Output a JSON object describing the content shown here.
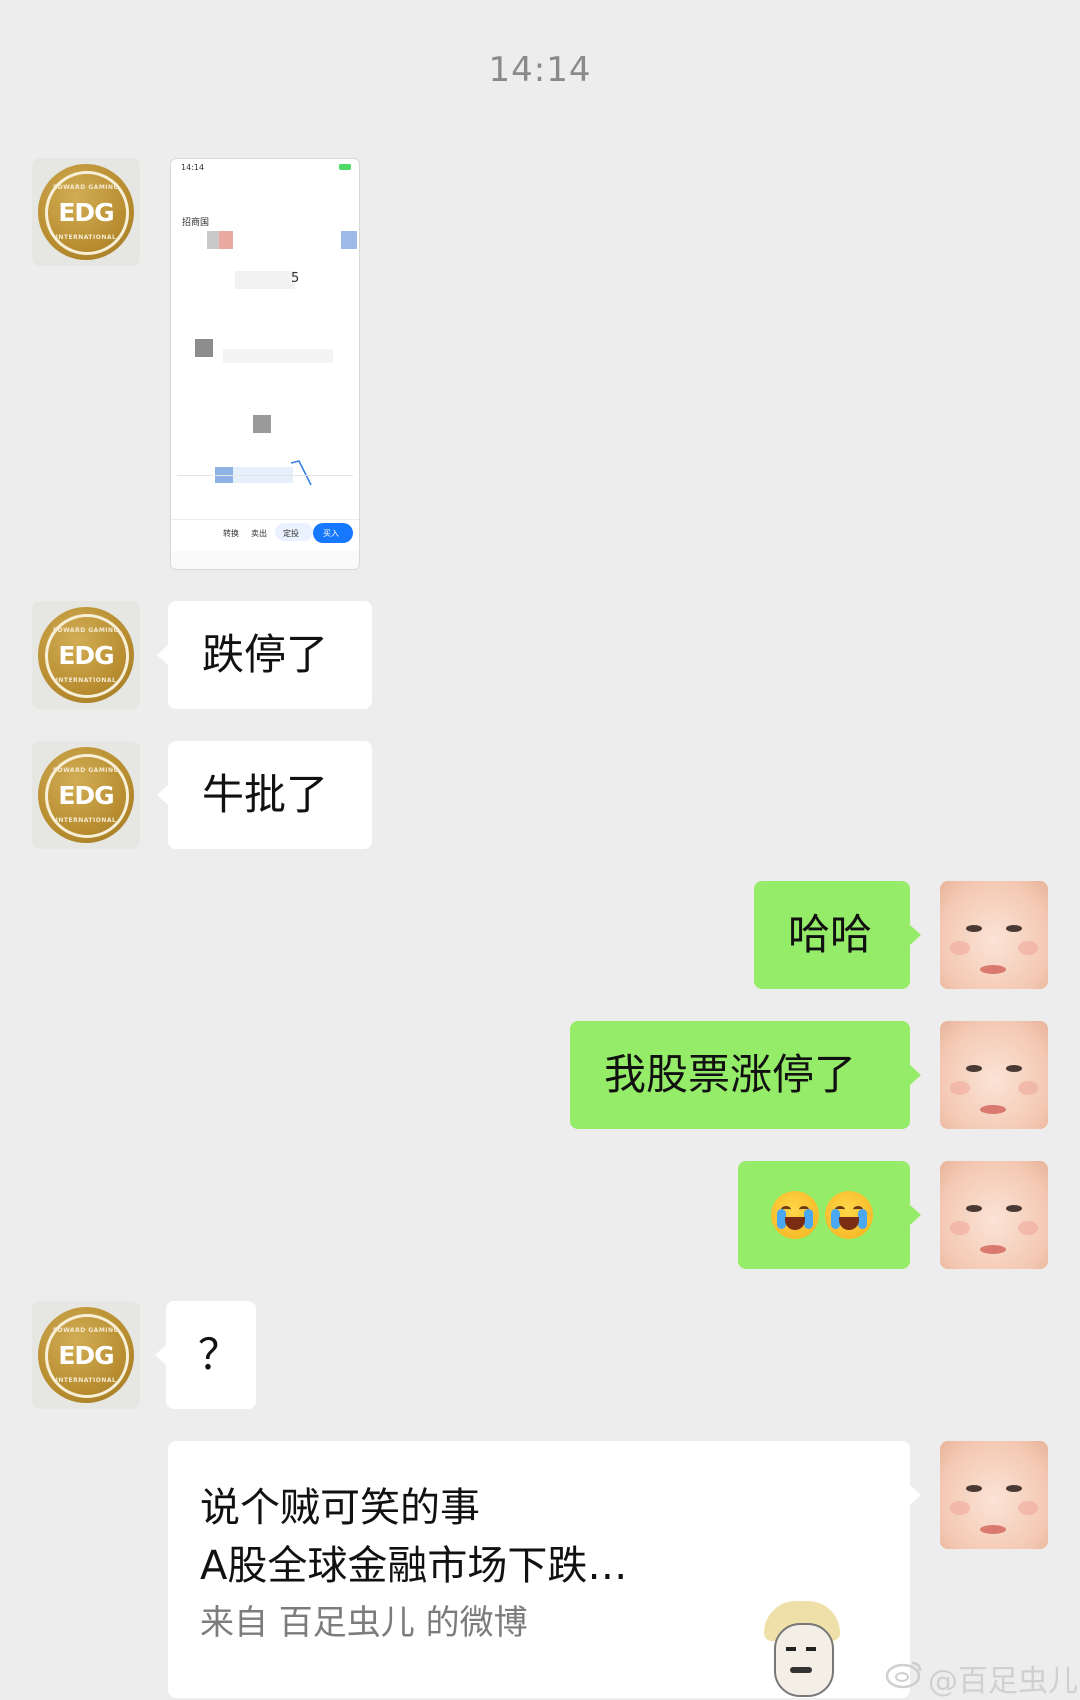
{
  "timestamp": "14:14",
  "messages": {
    "m2": "跌停了",
    "m3": "牛批了",
    "m4": "哈哈",
    "m5": "我股票涨停了",
    "m7": "？",
    "card": {
      "line1": "说个贼可笑的事",
      "line2": "A股全球金融市场下跌…",
      "source": "来自 百足虫儿 的微博"
    }
  },
  "screenshot": {
    "time": "14:14",
    "name": "招商国",
    "number": "5",
    "buttons": [
      "转换",
      "卖出",
      "定投",
      "买入"
    ]
  },
  "watermark": "@百足虫儿",
  "avatars": {
    "left_logo_text": "EDG",
    "left_logo_top": "EDWARD GAMING",
    "left_logo_bottom": "INTERNATIONAL"
  },
  "colors": {
    "background": "#ededed",
    "bubble_right": "#95ec69",
    "bubble_left": "#ffffff",
    "buy_button": "#1677ff"
  }
}
